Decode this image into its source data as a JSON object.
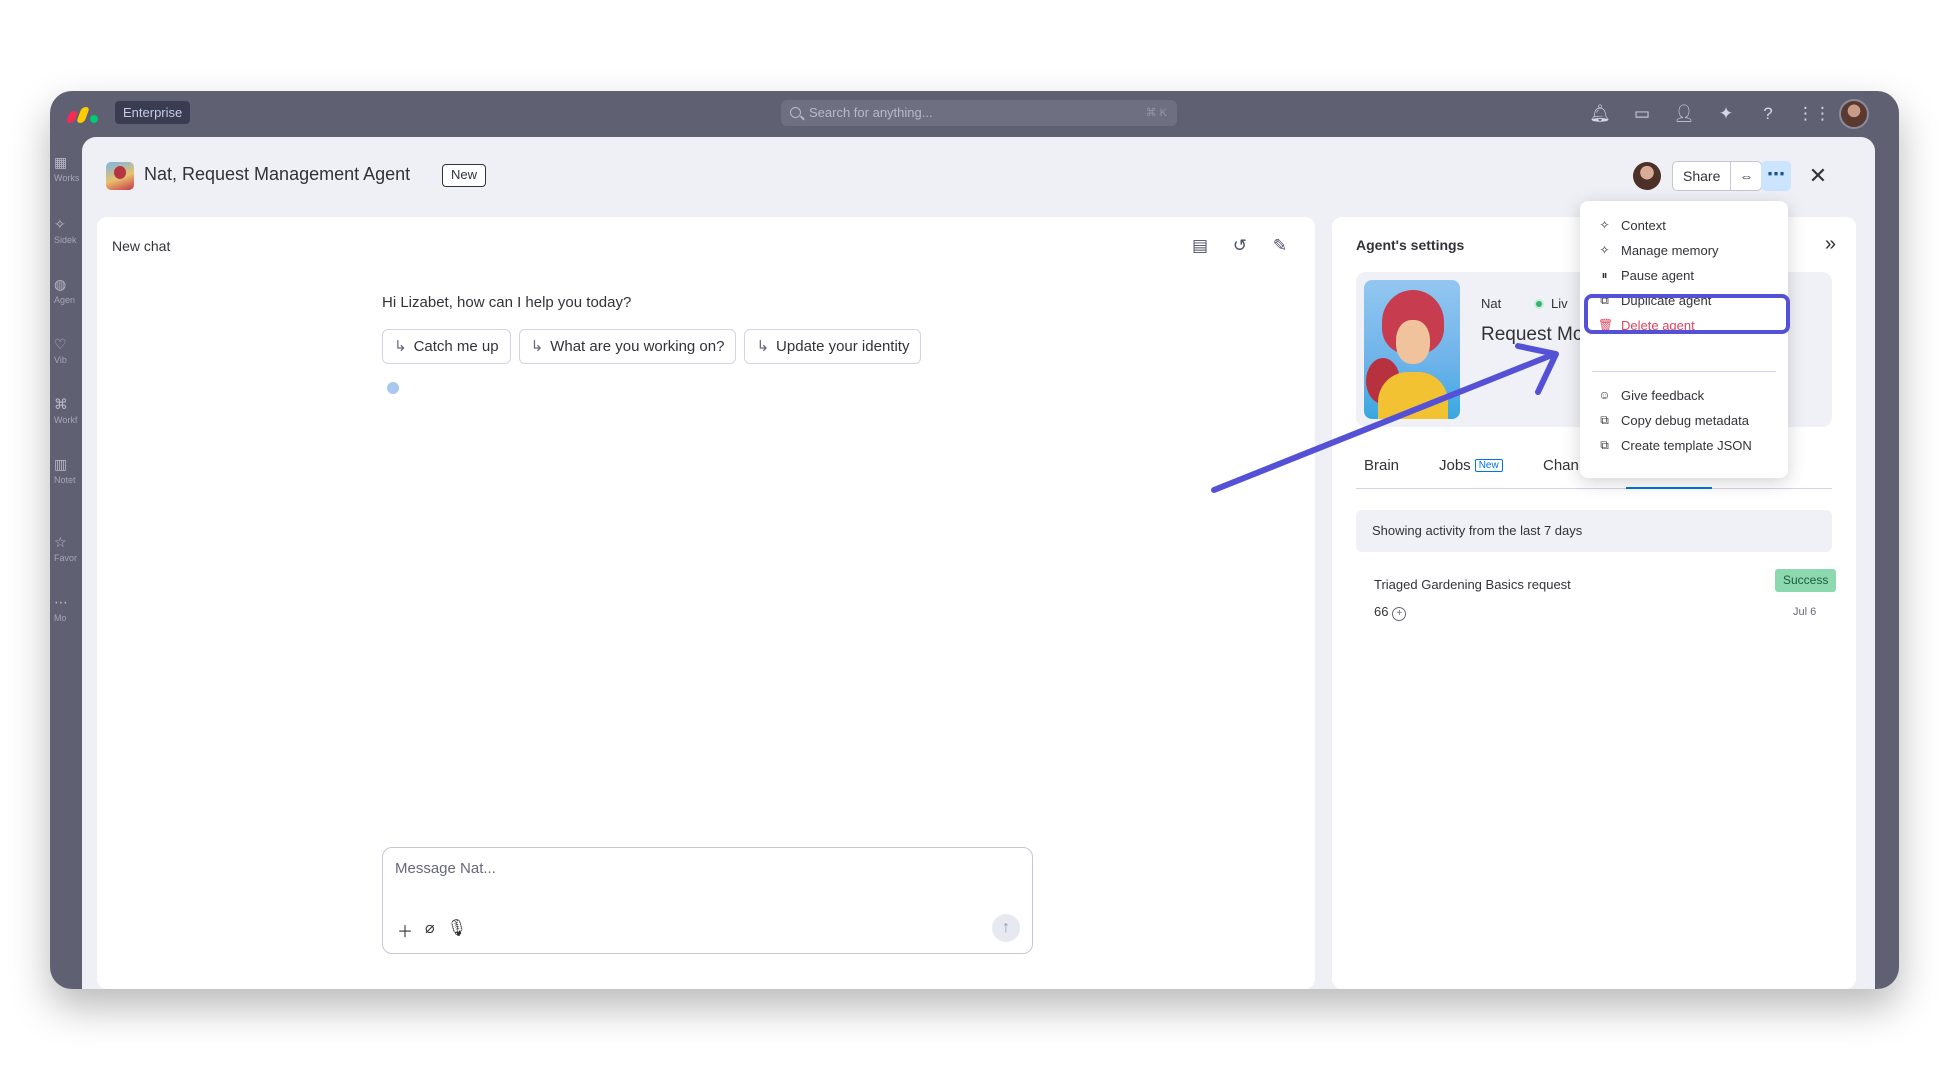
{
  "topbar": {
    "enterprise_label": "Enterprise",
    "search_placeholder": "Search for anything...",
    "search_shortcut": "⌘ K"
  },
  "left_rail": {
    "items": [
      {
        "label": "Works"
      },
      {
        "label": "Sidek"
      },
      {
        "label": "Agen"
      },
      {
        "label": "Vib"
      },
      {
        "label": "Workf"
      },
      {
        "label": "Notet"
      },
      {
        "label": "Favor"
      },
      {
        "label": "Mo"
      }
    ]
  },
  "modal": {
    "title": "Nat, Request Management Agent",
    "new_badge": "New",
    "share_label": "Share"
  },
  "chat": {
    "title": "New chat",
    "greeting": "Hi Lizabet, how can I help you today?",
    "suggestions": [
      {
        "label": "Catch me up"
      },
      {
        "label": "What are you working on?"
      },
      {
        "label": "Update your identity"
      }
    ],
    "composer_placeholder": "Message Nat..."
  },
  "settings": {
    "title": "Agent's settings",
    "agent_name": "Nat",
    "status_label": "Liv",
    "agent_role": "Request Mc",
    "tabs": [
      {
        "label": "Brain"
      },
      {
        "label": "Jobs",
        "badge": "New"
      },
      {
        "label": "Chan"
      }
    ],
    "activity_banner": "Showing activity from the last 7 days",
    "activity": {
      "title": "Triaged Gardening Basics request",
      "status": "Success",
      "count": "66",
      "date": "Jul 6"
    }
  },
  "menu": {
    "items": [
      {
        "label": "Context",
        "icon": "sparkle-icon"
      },
      {
        "label": "Manage memory",
        "icon": "sparkle-icon"
      },
      {
        "label": "Pause agent",
        "icon": "pause-icon"
      },
      {
        "label": "Duplicate agent",
        "icon": "copy-icon"
      },
      {
        "label": "Delete agent",
        "icon": "trash-icon"
      },
      {
        "label": "Give feedback",
        "icon": "feedback-icon"
      },
      {
        "label": "Copy debug metadata",
        "icon": "copy-icon"
      },
      {
        "label": "Create template JSON",
        "icon": "copy-icon"
      }
    ]
  },
  "colors": {
    "accent": "#0073ea",
    "highlight": "#5551d6",
    "danger": "#e2445c",
    "success": "#8cd9b0"
  }
}
